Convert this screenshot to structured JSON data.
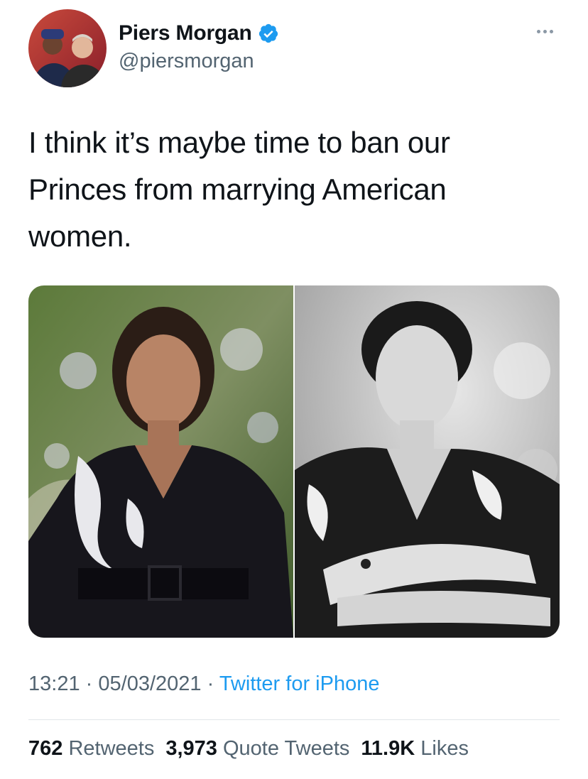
{
  "tweet": {
    "author": {
      "display_name": "Piers Morgan",
      "handle": "@piersmorgan",
      "verified": true,
      "verified_icon": "verified-badge-icon",
      "avatar_icon": "profile-photo"
    },
    "more_icon": "more-options-icon",
    "text": "I think it’s maybe time to ban our\nPrinces from marrying American\nwomen.",
    "media": [
      {
        "id": "photo-1",
        "style": "color photograph"
      },
      {
        "id": "photo-2",
        "style": "black and white photograph"
      }
    ],
    "meta": {
      "time": "13:21",
      "separator": "·",
      "date": "05/03/2021",
      "source": "Twitter for iPhone"
    },
    "stats": {
      "retweets_count": "762",
      "retweets_label": "Retweets",
      "quotes_count": "3,973",
      "quotes_label": "Quote Tweets",
      "likes_count": "11.9K",
      "likes_label": "Likes"
    }
  },
  "colors": {
    "text_primary": "#0f1419",
    "text_secondary": "#536471",
    "link": "#1d9bf0",
    "verified": "#1d9bf0",
    "divider": "#e1e6ea"
  }
}
